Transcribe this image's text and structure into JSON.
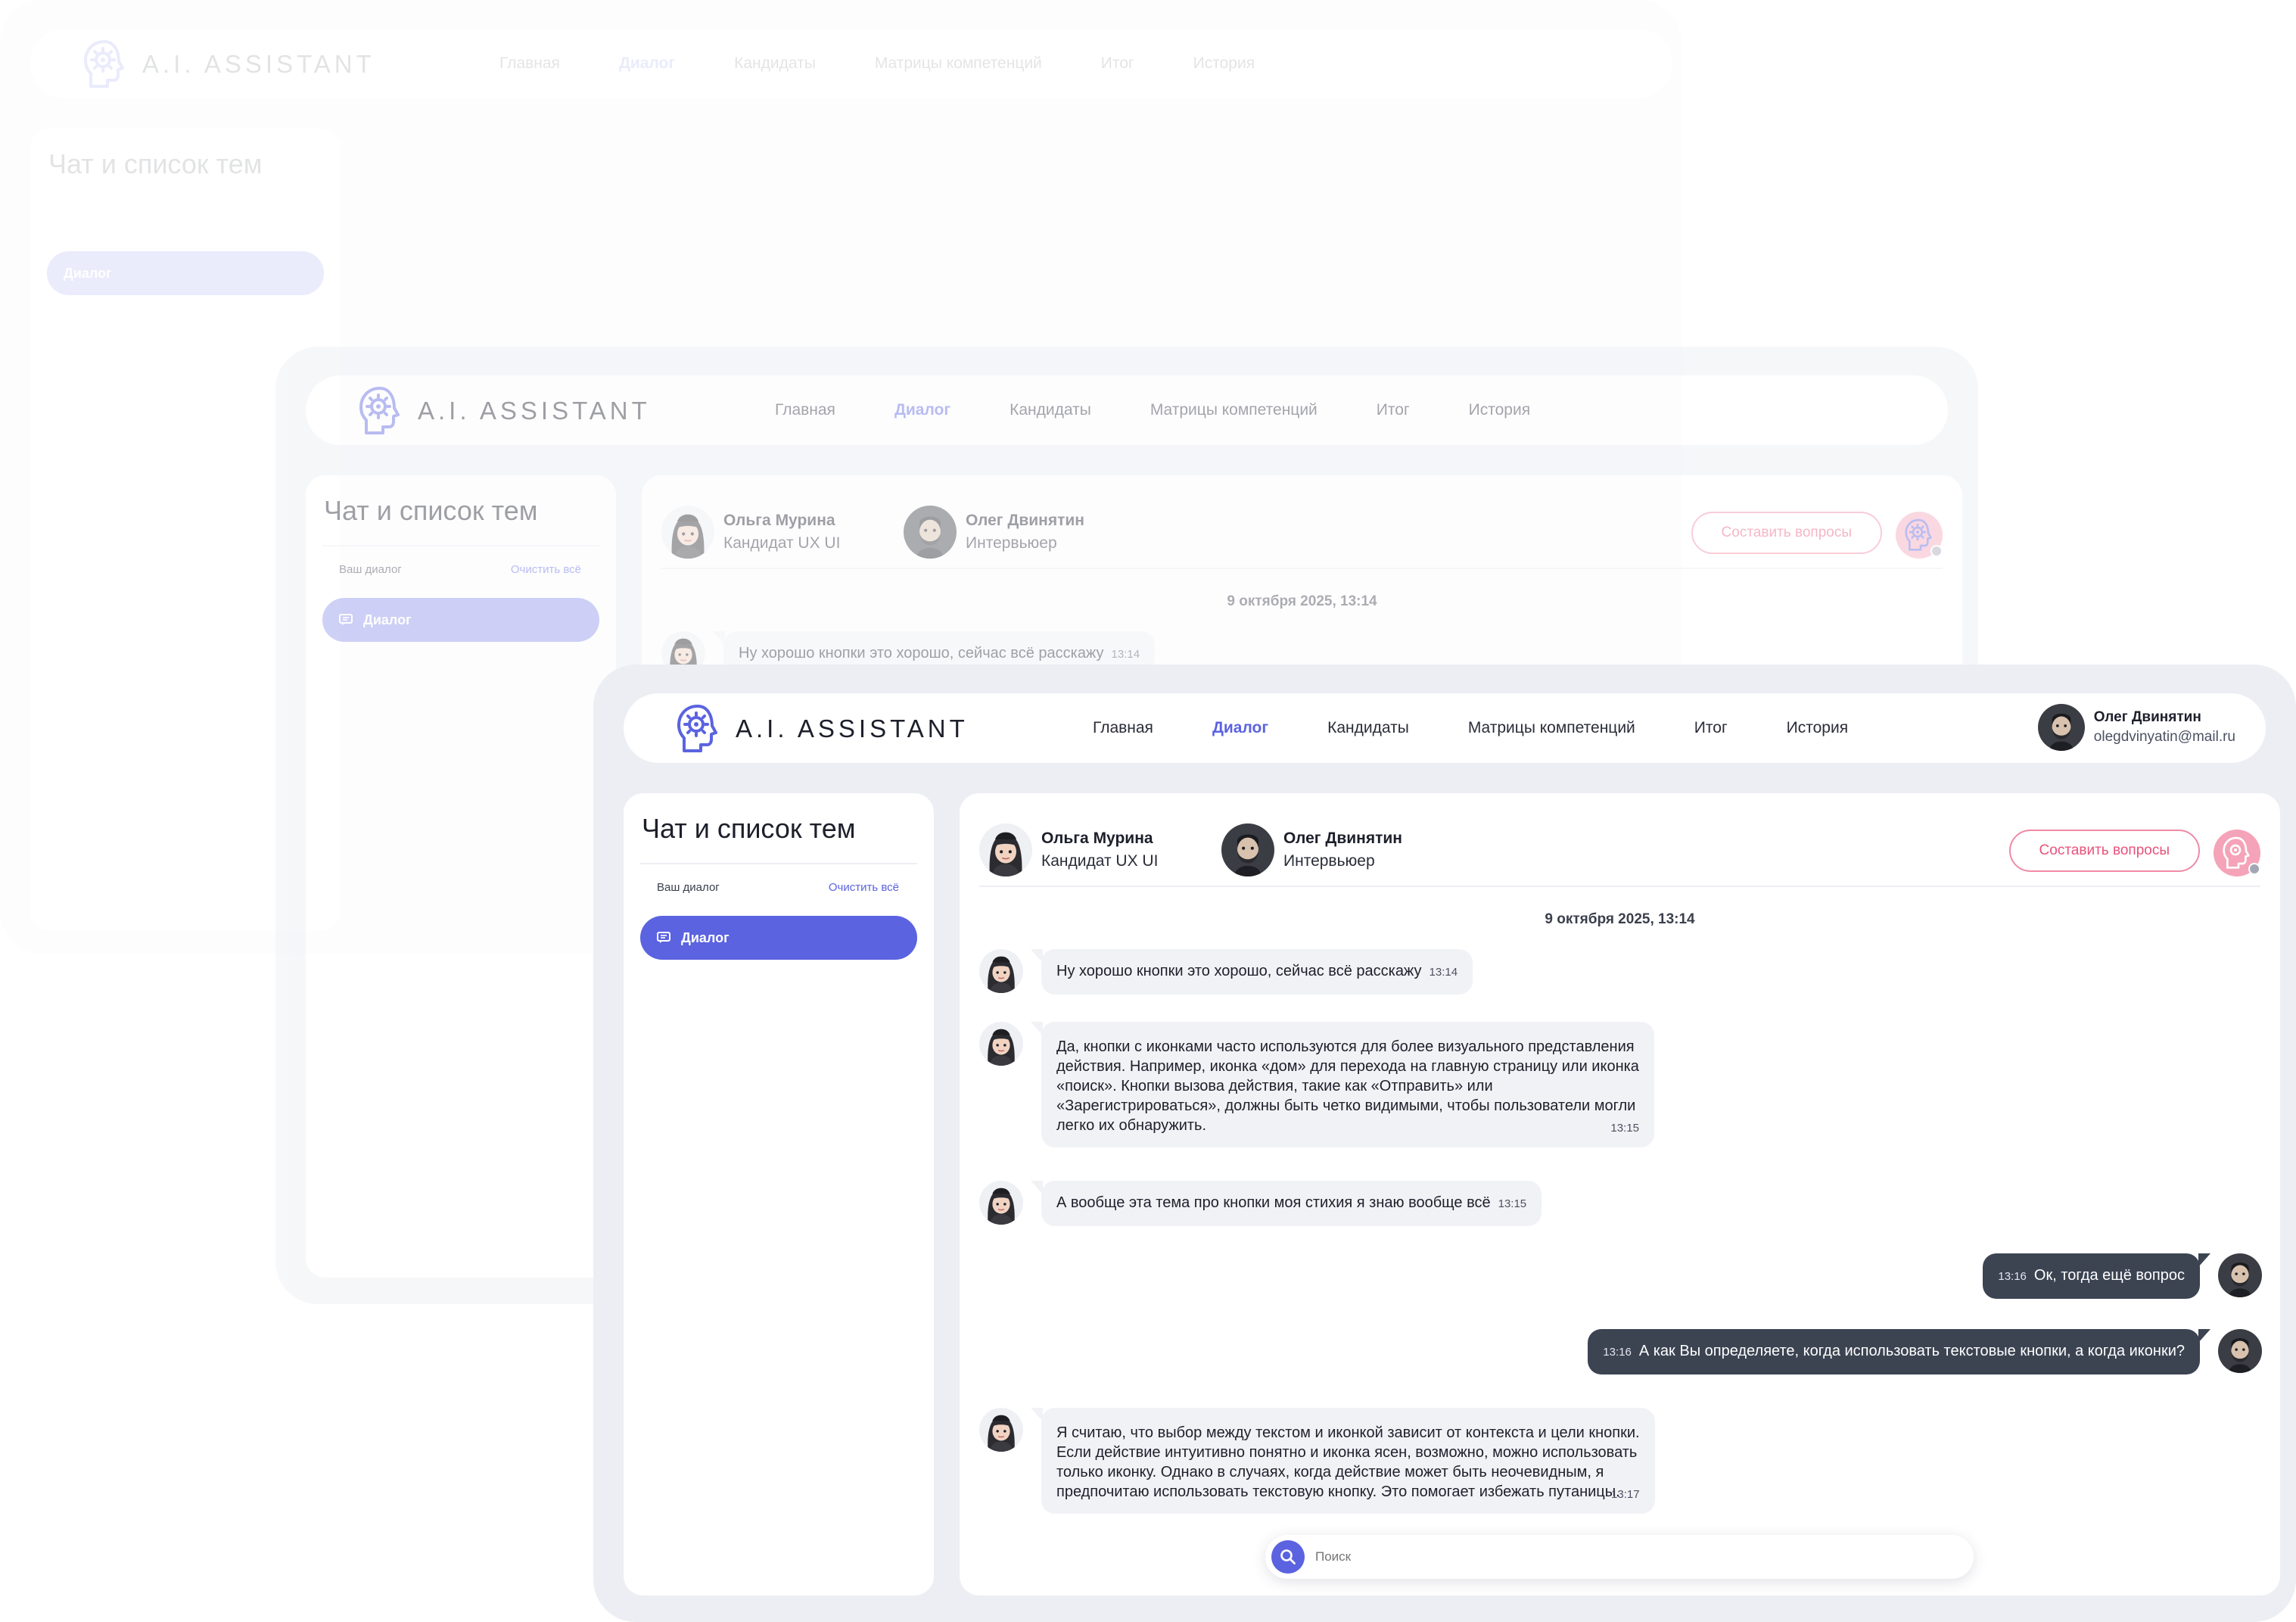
{
  "brand": {
    "name": "A.I. ASSISTANT"
  },
  "nav": {
    "items": [
      {
        "label": "Главная"
      },
      {
        "label": "Диалог",
        "active": true
      },
      {
        "label": "Кандидаты"
      },
      {
        "label": "Матрицы компетенций"
      },
      {
        "label": "Итог"
      },
      {
        "label": "История"
      }
    ]
  },
  "user": {
    "name": "Олег Двинятин",
    "email": "olegdvinyatin@mail.ru"
  },
  "sidebar": {
    "title": "Чат и список тем",
    "subtitle": "Ваш диалог",
    "clear_label": "Очистить всё",
    "items": [
      {
        "label": "Диалог",
        "icon": "chat-icon"
      }
    ]
  },
  "chat": {
    "candidate": {
      "name": "Ольга Мурина",
      "role": "Кандидат UX UI"
    },
    "interviewer": {
      "name": "Олег Двинятин",
      "role": "Интервьюер"
    },
    "compose_label": "Составить вопросы",
    "date": "9 октября 2025, 13:14",
    "messages": [
      {
        "from": "candidate",
        "text": "Ну хорошо кнопки это хорошо, сейчас всё расскажу",
        "time": "13:14"
      },
      {
        "from": "candidate",
        "lines": [
          " Да, кнопки с иконками часто используются для более визуального представления",
          "действия. Например, иконка «дом» для перехода на главную страницу или иконка",
          "«поиск». Кнопки вызова действия, такие как «Отправить» или",
          "«Зарегистрироваться», должны быть четко видимыми, чтобы пользователи могли",
          "легко их обнаружить."
        ],
        "time": "13:15"
      },
      {
        "from": "candidate",
        "text": "А вообще эта тема про кнопки моя стихия я знаю вообще всё",
        "time": "13:15"
      },
      {
        "from": "interviewer",
        "text": "Ок, тогда ещё вопрос",
        "time": "13:16"
      },
      {
        "from": "interviewer",
        "text": "А как Вы определяете, когда использовать текстовые кнопки, а когда иконки?",
        "time": "13:16"
      },
      {
        "from": "candidate",
        "lines": [
          "Я считаю, что выбор между текстом и иконкой зависит от контекста и цели кнопки.",
          "Если действие интуитивно понятно и иконка ясен, возможно, можно использовать",
          "только иконку. Однако в случаях, когда действие может быть неочевидным, я",
          "предпочитаю использовать текстовую кнопку. Это помогает избежать путаницы."
        ],
        "time": "13:17"
      }
    ]
  },
  "search": {
    "placeholder": "Поиск"
  },
  "colors": {
    "accent": "#5b63e0",
    "pink": "#e8527a",
    "bubble_out": "#3c4452",
    "bubble_in": "#f1f2f5",
    "frame": "#eceef3"
  }
}
